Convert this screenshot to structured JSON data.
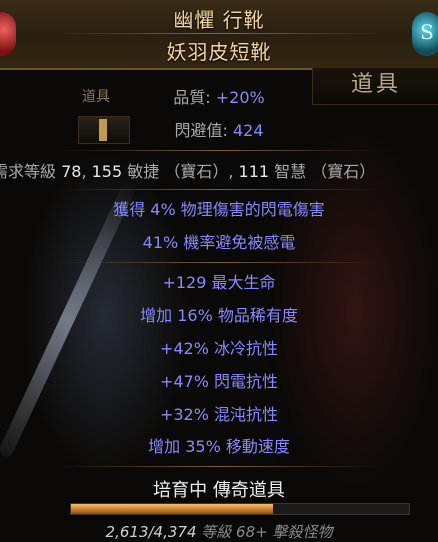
{
  "item": {
    "name": "幽懼 行靴",
    "base_type": "妖羽皮短靴"
  },
  "side_label": "道具",
  "tab_label": "道具",
  "properties": [
    {
      "label": "品質: ",
      "value": "+20%"
    },
    {
      "label": "閃避值: ",
      "value": "424"
    }
  ],
  "requirements": {
    "prefix": "需求等級 ",
    "level": "78",
    "sep1": ", ",
    "dex": "155",
    "dex_label": " 敏捷 （寶石）",
    "sep2": ", ",
    "int": "111",
    "int_label": " 智慧 （寶石）"
  },
  "implicit_mods": [
    "獲得 4% 物理傷害的閃電傷害",
    "41% 機率避免被感電"
  ],
  "explicit_mods": [
    "+129 最大生命",
    "增加 16% 物品稀有度",
    "+42% 冰冷抗性",
    "+47% 閃電抗性",
    "+32% 混沌抗性",
    "增加 35% 移動速度"
  ],
  "incubator": {
    "title": "培育中 傳奇道具",
    "progress_text": "2,613/4,374",
    "level_text": " 等級 68+ 擊殺怪物",
    "progress_fraction": 0.597
  }
}
